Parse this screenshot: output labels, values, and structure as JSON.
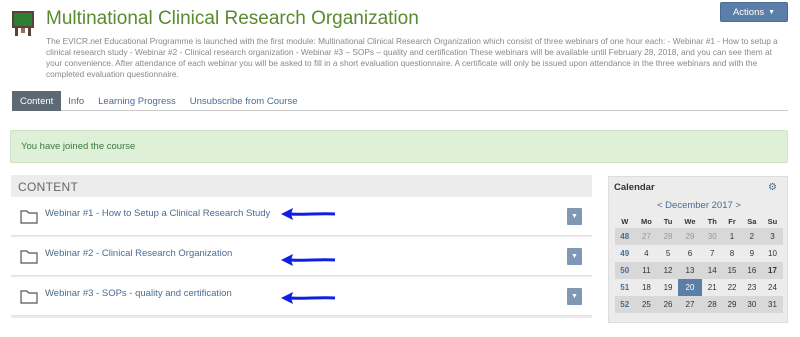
{
  "course": {
    "title": "Multinational Clinical Research Organization",
    "description": "The EVICR.net Educational Programme is launched with the first module: Multinational Clinical Research Organization which consist of three webinars of one hour each: - Webinar #1 - How to setup a clinical research study - Webinar #2 - Clinical research organization - Webinar #3 – SOPs – quality and certification These webinars will be available until February 28, 2018, and you can see them at your convenience. After attendance of each webinar you will be asked to fill in a short evaluation questionnaire. A certificate will only be issued upon attendance in the three webinars and with the completed evaluation questionnaire.",
    "actions_label": "Actions"
  },
  "tabs": [
    {
      "label": "Content",
      "active": true
    },
    {
      "label": "Info",
      "active": false
    },
    {
      "label": "Learning Progress",
      "active": false
    },
    {
      "label": "Unsubscribe from Course",
      "active": false
    }
  ],
  "alert": {
    "text": "You have joined the course"
  },
  "content": {
    "heading": "CONTENT",
    "modules": [
      {
        "title": "Webinar #1 - How to Setup a Clinical Research Study"
      },
      {
        "title": "Webinar #2 - Clinical Research Organization"
      },
      {
        "title": "Webinar #3 - SOPs - quality and certification"
      }
    ]
  },
  "calendar": {
    "title": "Calendar",
    "month_label": "< December 2017 >",
    "weekdays": [
      "W",
      "Mo",
      "Tu",
      "We",
      "Th",
      "Fr",
      "Sa",
      "Su"
    ],
    "weeks": [
      {
        "wk": "48",
        "days": [
          "27",
          "28",
          "29",
          "30",
          "1",
          "2",
          "3"
        ]
      },
      {
        "wk": "49",
        "days": [
          "4",
          "5",
          "6",
          "7",
          "8",
          "9",
          "10"
        ]
      },
      {
        "wk": "50",
        "days": [
          "11",
          "12",
          "13",
          "14",
          "15",
          "16",
          "17"
        ]
      },
      {
        "wk": "51",
        "days": [
          "18",
          "19",
          "20",
          "21",
          "22",
          "23",
          "24"
        ]
      },
      {
        "wk": "52",
        "days": [
          "25",
          "26",
          "27",
          "28",
          "29",
          "30",
          "31"
        ]
      }
    ]
  },
  "colors": {
    "title_green": "#5a8a2f",
    "link_blue": "#4a6c92",
    "alert_bg": "#dff0d8",
    "today_blue": "#5b7fa8",
    "annotation_arrow": "#1020e0"
  }
}
